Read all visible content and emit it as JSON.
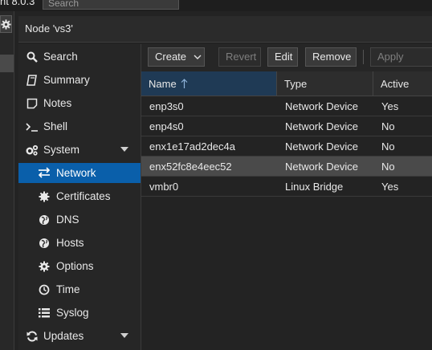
{
  "header": {
    "version_text": "nt 8.0.3",
    "search_placeholder": "Search"
  },
  "panel": {
    "title": "Node 'vs3'"
  },
  "nav": {
    "search": "Search",
    "summary": "Summary",
    "notes": "Notes",
    "shell": "Shell",
    "system": "System",
    "network": "Network",
    "certificates": "Certificates",
    "dns": "DNS",
    "hosts": "Hosts",
    "options": "Options",
    "time": "Time",
    "syslog": "Syslog",
    "updates": "Updates"
  },
  "toolbar": {
    "create": "Create",
    "revert": "Revert",
    "edit": "Edit",
    "remove": "Remove",
    "apply": "Apply Configuration"
  },
  "grid": {
    "columns": {
      "name": "Name",
      "type": "Type",
      "active": "Active"
    },
    "sorted_column": "Name",
    "sort_direction": "ascending",
    "selected_row": 3,
    "rows": [
      {
        "name": "enp3s0",
        "type": "Network Device",
        "active": "Yes"
      },
      {
        "name": "enp4s0",
        "type": "Network Device",
        "active": "No"
      },
      {
        "name": "enx1e17ad2dec4a",
        "type": "Network Device",
        "active": "No"
      },
      {
        "name": "enx52fc8e4eec52",
        "type": "Network Device",
        "active": "No"
      },
      {
        "name": "vmbr0",
        "type": "Linux Bridge",
        "active": "Yes"
      }
    ]
  },
  "colors": {
    "accent": "#0a5faa",
    "selected_row": "#4a4a4a",
    "sorted_header": "#1f3a55"
  }
}
